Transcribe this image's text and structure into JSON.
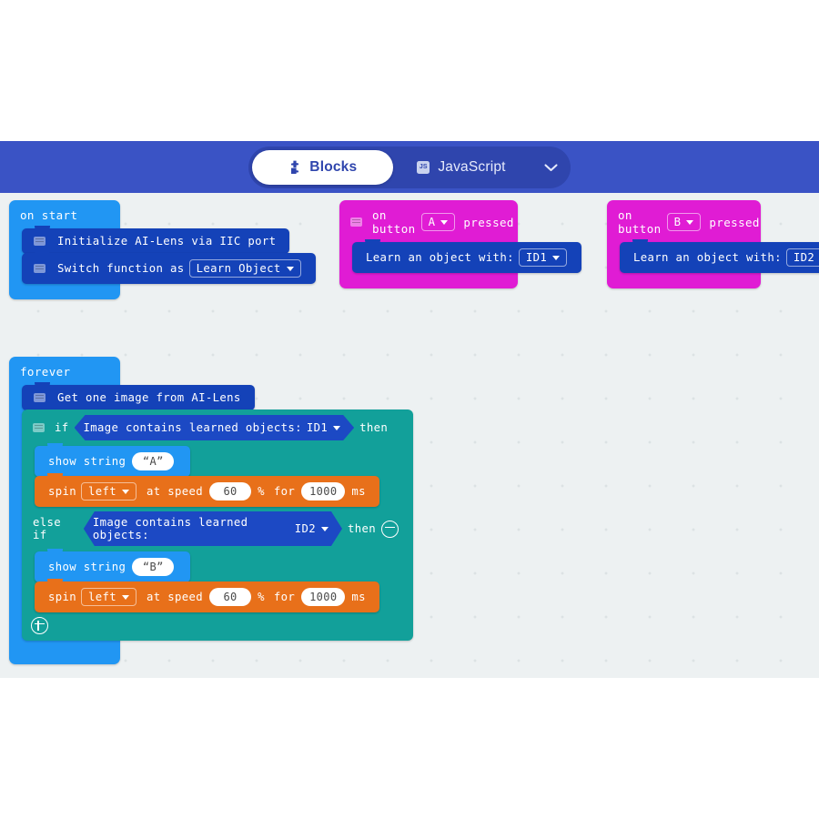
{
  "header": {
    "tabs": [
      {
        "label": "Blocks",
        "icon": "puzzle-piece-icon",
        "active": true
      },
      {
        "label": "JavaScript",
        "icon": "js-icon",
        "active": false
      }
    ],
    "dropdown_icon": "chevron-down-icon",
    "bar_color": "#3A53C5",
    "pill_color": "#2F45AD"
  },
  "canvas": {
    "background": "#EDF1F2",
    "grid": "dotted"
  },
  "blocks": {
    "on_start": {
      "label": "on start",
      "color": "#2196F3",
      "children": [
        {
          "text": "Initialize AI-Lens via IIC port",
          "color": "#1442B8",
          "icon": "comment-icon"
        },
        {
          "text": "Switch function as",
          "dropdown": "Learn Object",
          "color": "#1442B8",
          "icon": "comment-icon"
        }
      ]
    },
    "on_button_a": {
      "prefix": "on button",
      "dropdown": "A",
      "suffix": "pressed",
      "color": "#E01CD4",
      "icon": "comment-icon",
      "children": [
        {
          "text": "Learn an object with:",
          "dropdown": "ID1",
          "color": "#1442B8"
        }
      ]
    },
    "on_button_b": {
      "prefix": "on button",
      "dropdown": "B",
      "suffix": "pressed",
      "color": "#E01CD4",
      "children": [
        {
          "text": "Learn an object with:",
          "dropdown": "ID2",
          "color": "#1442B8"
        }
      ]
    },
    "forever": {
      "label": "forever",
      "color": "#2196F3",
      "get_image": {
        "text": "Get one image from AI-Lens",
        "color": "#1442B8",
        "icon": "comment-icon"
      },
      "if_block": {
        "color": "#12A09A",
        "if_label": "if",
        "if_condition": {
          "text": "Image contains learned objects:",
          "dropdown": "ID1"
        },
        "then_label": "then",
        "if_body": [
          {
            "type": "show_string",
            "text": "show string",
            "value": "“A”",
            "color": "#2196F3"
          },
          {
            "type": "spin",
            "text": "spin",
            "direction": "left",
            "speed_label": "at speed",
            "speed": "60",
            "percent_label": "%",
            "for_label": "for",
            "duration": "1000",
            "unit": "ms",
            "color": "#E8701A"
          }
        ],
        "elseif_label": "else if",
        "elseif_condition": {
          "text": "Image contains learned objects:",
          "dropdown": "ID2"
        },
        "elseif_then_label": "then",
        "minus_icon": "minus-circle-icon",
        "else_body": [
          {
            "type": "show_string",
            "text": "show string",
            "value": "“B”",
            "color": "#2196F3"
          },
          {
            "type": "spin",
            "text": "spin",
            "direction": "left",
            "speed_label": "at speed",
            "speed": "60",
            "percent_label": "%",
            "for_label": "for",
            "duration": "1000",
            "unit": "ms",
            "color": "#E8701A"
          }
        ],
        "plus_icon": "plus-circle-icon"
      }
    }
  }
}
